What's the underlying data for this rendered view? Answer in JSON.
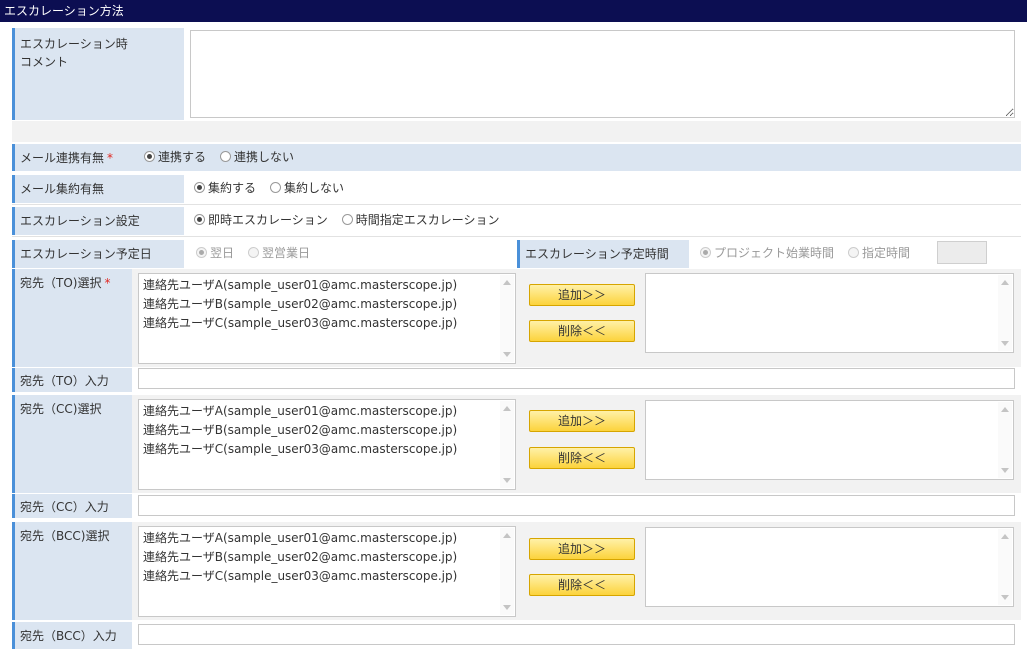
{
  "section_title": "エスカレーション方法",
  "comment": {
    "label_line1": "エスカレーション時",
    "label_line2": "コメント",
    "value": ""
  },
  "mail_link": {
    "label": "メール連携有無",
    "required_mark": "*",
    "options": [
      "連携する",
      "連携しない"
    ],
    "selected": "連携する"
  },
  "mail_aggregate": {
    "label": "メール集約有無",
    "options": [
      "集約する",
      "集約しない"
    ],
    "selected": "集約する"
  },
  "escalation_setting": {
    "label": "エスカレーション設定",
    "options": [
      "即時エスカレーション",
      "時間指定エスカレーション"
    ],
    "selected": "即時エスカレーション"
  },
  "escalation_date": {
    "label": "エスカレーション予定日",
    "options": [
      "翌日",
      "翌営業日"
    ],
    "selected": "翌日"
  },
  "escalation_time": {
    "label": "エスカレーション予定時間",
    "options": [
      "プロジェクト始業時間",
      "指定時間"
    ],
    "selected": "プロジェクト始業時間",
    "time_value": ""
  },
  "contacts": [
    "連絡先ユーザA(sample_user01@amc.masterscope.jp)",
    "連絡先ユーザB(sample_user02@amc.masterscope.jp)",
    "連絡先ユーザC(sample_user03@amc.masterscope.jp)"
  ],
  "buttons": {
    "add": "追加＞＞",
    "remove": "削除＜＜"
  },
  "to": {
    "select_label": "宛先（TO)選択",
    "required_mark": "*",
    "input_label": "宛先（TO）入力",
    "input_value": ""
  },
  "cc": {
    "select_label": "宛先（CC)選択",
    "input_label": "宛先（CC）入力",
    "input_value": ""
  },
  "bcc": {
    "select_label": "宛先（BCC)選択",
    "input_label": "宛先（BCC）入力",
    "input_value": ""
  }
}
